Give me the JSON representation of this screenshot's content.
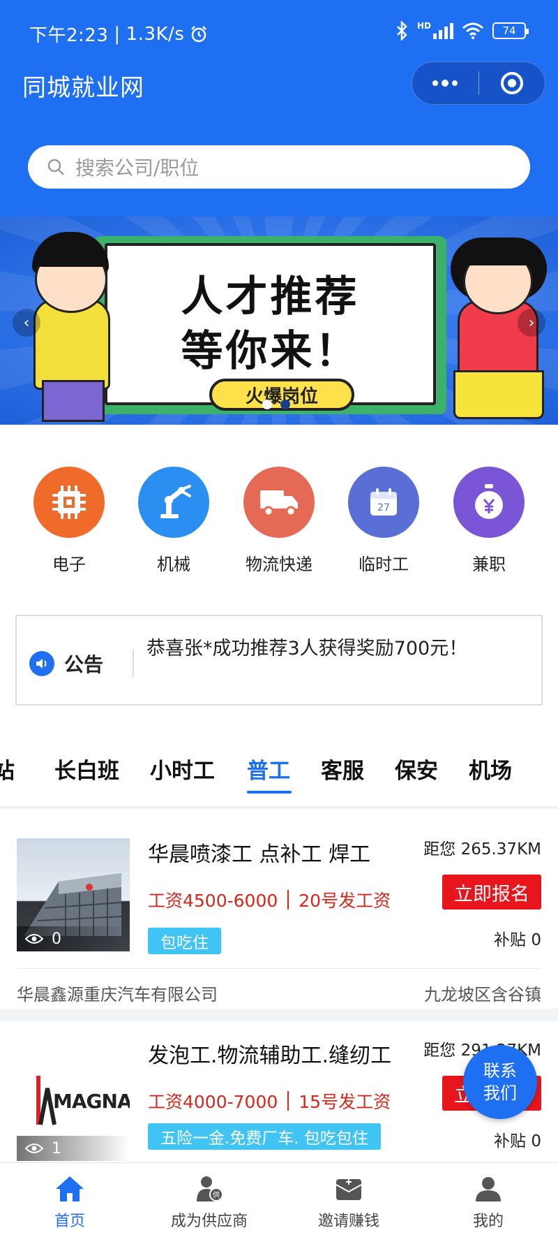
{
  "status_bar": {
    "time": "下午2:23",
    "speed": "1.3K/s",
    "network": "HD",
    "battery": "74"
  },
  "header": {
    "app_title": "同城就业网"
  },
  "search": {
    "placeholder": "搜索公司/职位"
  },
  "banner": {
    "title_line1": "人才推荐",
    "title_line2": "等你来！",
    "tag": "火爆岗位"
  },
  "categories": [
    {
      "label": "电子",
      "icon": "chip-icon",
      "color": "#f06a2a"
    },
    {
      "label": "机械",
      "icon": "robot-arm-icon",
      "color": "#2a8ff0"
    },
    {
      "label": "物流快递",
      "icon": "truck-icon",
      "color": "#e56a55"
    },
    {
      "label": "临时工",
      "icon": "calendar-icon",
      "color": "#5a6fd6"
    },
    {
      "label": "兼职",
      "icon": "stopwatch-yen-icon",
      "color": "#7a55d6"
    }
  ],
  "notice": {
    "title": "公告",
    "text": "恭喜张*成功推荐3人获得奖励700元！"
  },
  "tabs": [
    {
      "label": "站"
    },
    {
      "label": "长白班"
    },
    {
      "label": "小时工"
    },
    {
      "label": "普工",
      "active": true
    },
    {
      "label": "客服"
    },
    {
      "label": "保安"
    },
    {
      "label": "机场"
    }
  ],
  "jobs": [
    {
      "title": "华晨喷漆工 点补工 焊工",
      "salary": "工资4500-6000",
      "payday": "20号发工资",
      "tag": "包吃住",
      "distance": "距您 265.37KM",
      "apply": "立即报名",
      "subsidy": "补贴 0",
      "views": "0",
      "company": "华晨鑫源重庆汽车有限公司",
      "location": "九龙坡区含谷镇"
    },
    {
      "title": "发泡工.物流辅助工.缝纫工",
      "salary": "工资4000-7000",
      "payday": "15号发工资",
      "tag": "五险一金.免费厂车. 包吃包住",
      "distance": "距您 291.27KM",
      "apply": "立即报名",
      "subsidy": "补贴 0",
      "views": "1",
      "logo_text": "MAGNA"
    }
  ],
  "contact": {
    "line1": "联系",
    "line2": "我们"
  },
  "bottom_nav": [
    {
      "label": "首页",
      "icon": "home-icon",
      "active": true
    },
    {
      "label": "成为供应商",
      "icon": "supplier-icon"
    },
    {
      "label": "邀请赚钱",
      "icon": "invite-icon"
    },
    {
      "label": "我的",
      "icon": "profile-icon"
    }
  ]
}
